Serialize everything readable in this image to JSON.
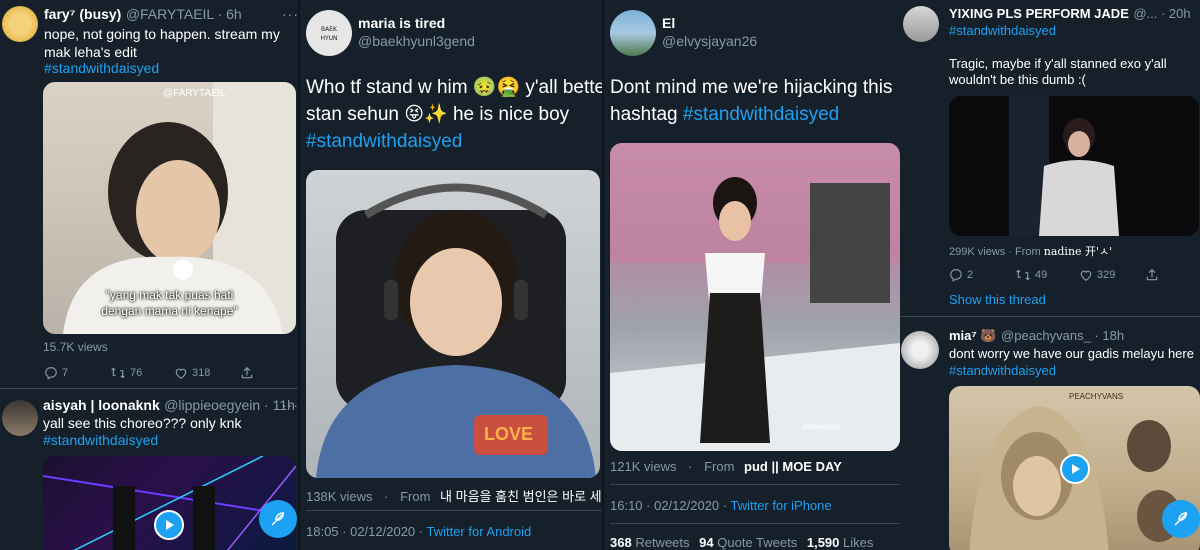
{
  "col1": {
    "tweet1": {
      "name": "fary⁷ (busy)",
      "handle": "@FARYTAEIL · 6h",
      "text": "nope, not going to happen. stream my mak leha's edit",
      "hashtag": "#standwithdaisyed",
      "watermark": "@FARYTAEIL",
      "caption_line1": "\"yang mak tak puas hati",
      "caption_line2": "dengan mama ni kenape\"",
      "views": "15.7K views",
      "replies": "7",
      "retweets": "76",
      "likes": "318"
    },
    "tweet2": {
      "name": "aisyah | loonaknk",
      "handle": "@lippieoegyein · 11h",
      "text": "yall see this choreo??? only knk",
      "hashtag": "#standwithdaisyed"
    }
  },
  "col2": {
    "name": "maria is tired",
    "handle": "@baekhyunl3gend",
    "text_line1": "Who tf stand w him 🤢🤮 y'all better",
    "text_line2": "stan sehun 😝✨ he is nice boy",
    "hashtag": "#standwithdaisyed",
    "shirt_text": "LOVE",
    "views": "138K views",
    "from_label": "From",
    "from_source": "내 마음을 훔친 범인은 바로 세…",
    "time": "18:05 · 02/12/2020 · ",
    "client": "Twitter for Android"
  },
  "col3": {
    "name": "El",
    "handle": "@elvysjayan26",
    "text_line1": "Dont mind me we're hijacking this",
    "text_line2": "hashtag",
    "hashtag": "#standwithdaisyed",
    "watermark": "wheeinsnz",
    "views": "121K views",
    "from_label": "From",
    "from_source": "pud || MOE DAY",
    "time": "16:10 · 02/12/2020 · ",
    "client": "Twitter for iPhone",
    "retweets_count": "368",
    "retweets_label": "Retweets",
    "quotes_count": "94",
    "quotes_label": "Quote Tweets",
    "likes_count": "1,590",
    "likes_label": "Likes"
  },
  "col4": {
    "tweet1": {
      "name": "YIXING PLS PERFORM JADE",
      "handle": "@... · 20h",
      "hashtag": "#standwithdaisyed",
      "text": "Tragic, maybe if y'all stanned exo y'all wouldn't be this dumb :(",
      "views": "299K views · From ",
      "from_source": "nadine 开'ㅅ'",
      "replies": "2",
      "retweets": "49",
      "likes": "329",
      "show_thread": "Show this thread"
    },
    "tweet2": {
      "name": "mia⁷ 🐻",
      "handle": "@peachyvans_ · 18h",
      "text": "dont worry we have our gadis melayu here",
      "hashtag": "#standwithdaisyed",
      "watermark": "PEACHYVANS"
    }
  },
  "more_glyph": "···",
  "colors": {
    "background": "#15202b",
    "accent": "#1da1f2",
    "muted": "#8899a6"
  }
}
